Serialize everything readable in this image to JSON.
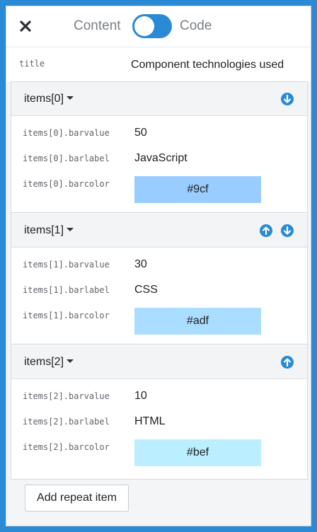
{
  "toolbar": {
    "close_icon": "close-icon",
    "mode_content_label": "Content",
    "mode_code_label": "Code",
    "toggle_state": "content"
  },
  "title_field": {
    "key": "title",
    "value": "Component technologies used"
  },
  "items": [
    {
      "header": "items[0]",
      "controls": [
        "move-down-icon"
      ],
      "barvalue_key": "items[0].barvalue",
      "barvalue": "50",
      "barlabel_key": "items[0].barlabel",
      "barlabel": "JavaScript",
      "barcolor_key": "items[0].barcolor",
      "barcolor": "#9cf",
      "swatch_hex": "#99ccff"
    },
    {
      "header": "items[1]",
      "controls": [
        "move-up-icon",
        "move-down-icon"
      ],
      "barvalue_key": "items[1].barvalue",
      "barvalue": "30",
      "barlabel_key": "items[1].barlabel",
      "barlabel": "CSS",
      "barcolor_key": "items[1].barcolor",
      "barcolor": "#adf",
      "swatch_hex": "#aaddff"
    },
    {
      "header": "items[2]",
      "controls": [
        "move-up-icon"
      ],
      "barvalue_key": "items[2].barvalue",
      "barvalue": "10",
      "barlabel_key": "items[2].barlabel",
      "barlabel": "HTML",
      "barcolor_key": "items[2].barcolor",
      "barcolor": "#bef",
      "swatch_hex": "#bbeeff"
    }
  ],
  "add_button_label": "Add repeat item",
  "colors": {
    "accent": "#2a8ad6",
    "icon_blue": "#2a8ad6"
  }
}
